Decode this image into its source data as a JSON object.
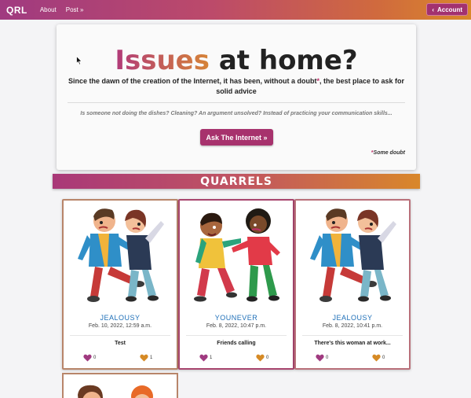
{
  "navbar": {
    "brand": "QRL",
    "links": [
      "About",
      "Post »"
    ],
    "account_label": "Account",
    "account_icon": "chevron-left-icon"
  },
  "hero": {
    "title_accent": "Issues",
    "title_rest": "at home?",
    "lead_part1": "Since the dawn of the creation of the Internet, it has been, without a doubt",
    "lead_star": "*",
    "lead_part2": ", the best place to ask for solid advice",
    "subtext": "Is someone not doing the dishes? Cleaning? An argument unsolved? Instead of practicing your communication skills...",
    "cta_label": "Ask The Internet »",
    "footnote_star": "*",
    "footnote_text": "Some doubt"
  },
  "section": {
    "title": "QUARRELS"
  },
  "cards": [
    {
      "author": "JEALOUSY",
      "date": "Feb. 10, 2022, 12:59 a.m.",
      "subject": "Test",
      "likes": "0",
      "dislikes": "1"
    },
    {
      "author": "YOUNEVER",
      "date": "Feb. 8, 2022, 10:47 p.m.",
      "subject": "Friends calling",
      "likes": "1",
      "dislikes": "0"
    },
    {
      "author": "JEALOUSY",
      "date": "Feb. 8, 2022, 10:41 p.m.",
      "subject": "There's this woman at work...",
      "likes": "0",
      "dislikes": "0"
    }
  ],
  "colors": {
    "accent": "#a7326d",
    "accent_orange": "#d9872a",
    "link": "#1e6fb8",
    "heart_like": "#a03a80",
    "heart_dislike": "#d68a25"
  }
}
